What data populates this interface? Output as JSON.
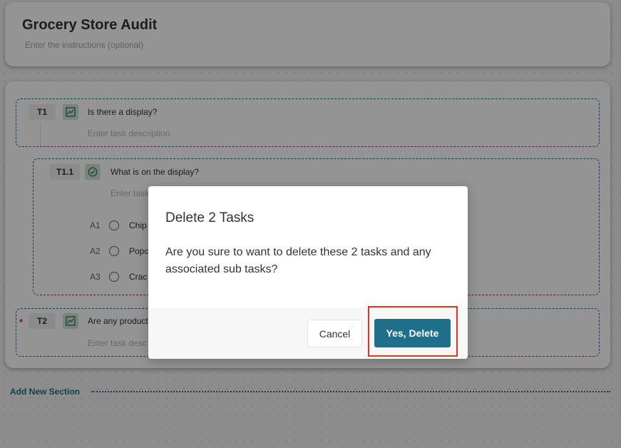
{
  "colors": {
    "accent": "#1f6f8b",
    "required": "#d32f2f",
    "highlight_box": "#e8321f",
    "icon_bg": "#cfe6da"
  },
  "header": {
    "title": "Grocery Store Audit",
    "instructions_placeholder": "Enter the instructions (optional)"
  },
  "tasks": [
    {
      "id": "T1",
      "icon": "image-icon",
      "question": "Is there a display?",
      "description_placeholder": "Enter task description",
      "required": false
    },
    {
      "id": "T1.1",
      "icon": "check-circle-icon",
      "question": "What is on the display?",
      "description_placeholder": "Enter task",
      "required": false,
      "answers": [
        {
          "label": "A1",
          "text": "Chip"
        },
        {
          "label": "A2",
          "text": "Popc"
        },
        {
          "label": "A3",
          "text": "Crac"
        }
      ]
    },
    {
      "id": "T2",
      "icon": "image-icon",
      "question": "Are any product",
      "description_placeholder": "Enter task desc",
      "required": true,
      "required_mark": "*"
    }
  ],
  "add_section_label": "Add New Section",
  "modal": {
    "title": "Delete 2 Tasks",
    "body": "Are you sure to want to delete these 2 tasks and any associated sub tasks?",
    "cancel_label": "Cancel",
    "confirm_label": "Yes, Delete"
  }
}
